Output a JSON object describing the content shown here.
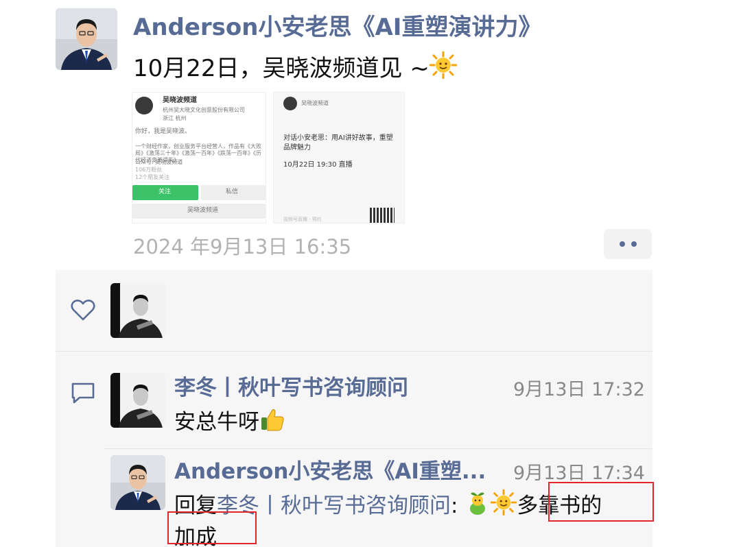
{
  "post": {
    "author": "Anderson小安老思《AI重塑演讲力》",
    "text": "10月22日，吴晓波频道见 ~",
    "time": "2024 年9月13日 16:35",
    "thumbnail_left": {
      "name": "吴晓波频道",
      "subtitle": "杭州吴大晓文化创意股份有限公司",
      "region": "浙江 杭州",
      "greeting": "你好，我是吴晓波。",
      "bio1": "一个财经作家，创业服务平台经营人，作品有《大败局》《激荡三十年》《激荡一百年》《跌荡一百年》《历代经济变革得失》",
      "bio2": "公众号: 吴晓波频道",
      "fans1": "106万粉丝",
      "fans2": "12个朋友关注",
      "follow_label": "关注",
      "message_label": "私信",
      "shop_label": "吴晓波频道"
    },
    "thumbnail_right": {
      "channel": "吴晓波频道",
      "title": "对话小安老思：用AI讲好故事，重塑品牌魅力",
      "schedule": "10月22日 19:30 直播",
      "footer": "视频号直播 · 预约"
    }
  },
  "comment": {
    "name": "李冬丨秋叶写书咨询顾问",
    "time": "9月13日 17:32",
    "text": "安总牛呀"
  },
  "reply": {
    "name": "Anderson小安老思《AI重塑...",
    "time": "9月13日 17:34",
    "prefix": "回复",
    "target": "李冬丨秋叶写书咨询顾问",
    "colon": ":",
    "text": "多靠书的",
    "text2": "加成"
  },
  "icons": {
    "like": "heart-icon",
    "comment": "comment-bubble-icon",
    "more": "more-dots-icon",
    "sun": "sun-emoji-icon",
    "thumbs": "thumbs-up-emoji-icon",
    "sprout": "sprout-emoji-icon"
  },
  "colors": {
    "name_link": "#576b95",
    "timestamp": "#b2b2b2",
    "panel_bg": "#f6f6f6",
    "highlight_box": "#e0262b"
  }
}
